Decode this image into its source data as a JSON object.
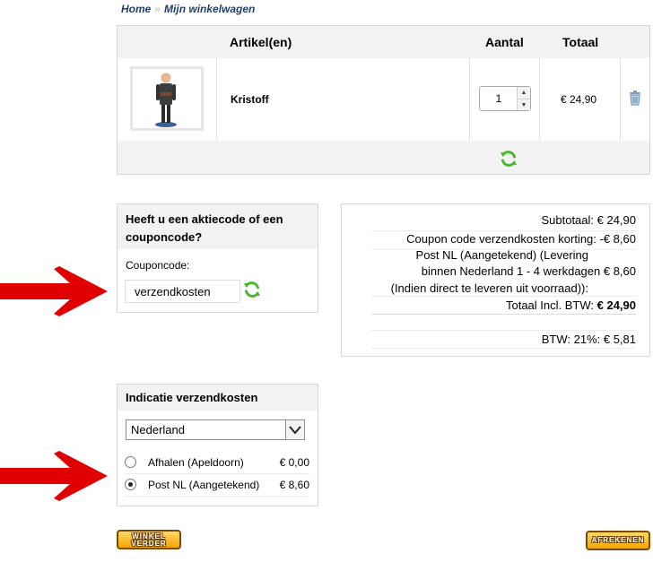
{
  "breadcrumb": {
    "home": "Home",
    "separator": "»",
    "current": "Mijn winkelwagen"
  },
  "cart": {
    "headers": {
      "item": "Artikel(en)",
      "quantity": "Aantal",
      "total": "Totaal"
    },
    "items": [
      {
        "name": "Kristoff",
        "quantity": "1",
        "price": "€ 24,90",
        "thumbnail_icon": "figurine-image",
        "delete_icon": "trash-icon"
      }
    ],
    "refresh_icon": "refresh-icon"
  },
  "coupon": {
    "title": "Heeft u een aktiecode of een couponcode?",
    "label": "Couponcode:",
    "value": "verzendkosten",
    "apply_icon": "refresh-icon"
  },
  "totals": {
    "subtotal": "Subtotaal: € 24,90",
    "discount": "Coupon code verzendkosten korting:  -€ 8,60",
    "shipping_line1": "Post NL (Aangetekend) (Levering",
    "shipping_line2": "binnen Nederland 1 - 4 werkdagen  € 8,60",
    "shipping_line3": "(Indien direct te leveren uit voorraad)):",
    "total_label": "Totaal Incl. BTW: ",
    "total_value": "€ 24,90",
    "vat": "BTW: 21%:   € 5,81"
  },
  "shipping": {
    "title": "Indicatie verzendkosten",
    "country": "Nederland",
    "options": [
      {
        "name": "Afhalen (Apeldoorn)",
        "cost": "€ 0,00",
        "selected": false
      },
      {
        "name": "Post NL (Aangetekend)",
        "cost": "€ 8,60",
        "selected": true
      }
    ]
  },
  "buttons": {
    "continue_line1": "WINKEL",
    "continue_line2": "VERDER",
    "checkout": "AFREKENEN"
  },
  "colors": {
    "accent_orange": "#f4a300",
    "arrow_red": "#e00000",
    "refresh_green": "#4cb82e",
    "breadcrumb_blue": "#1f3f6b"
  }
}
